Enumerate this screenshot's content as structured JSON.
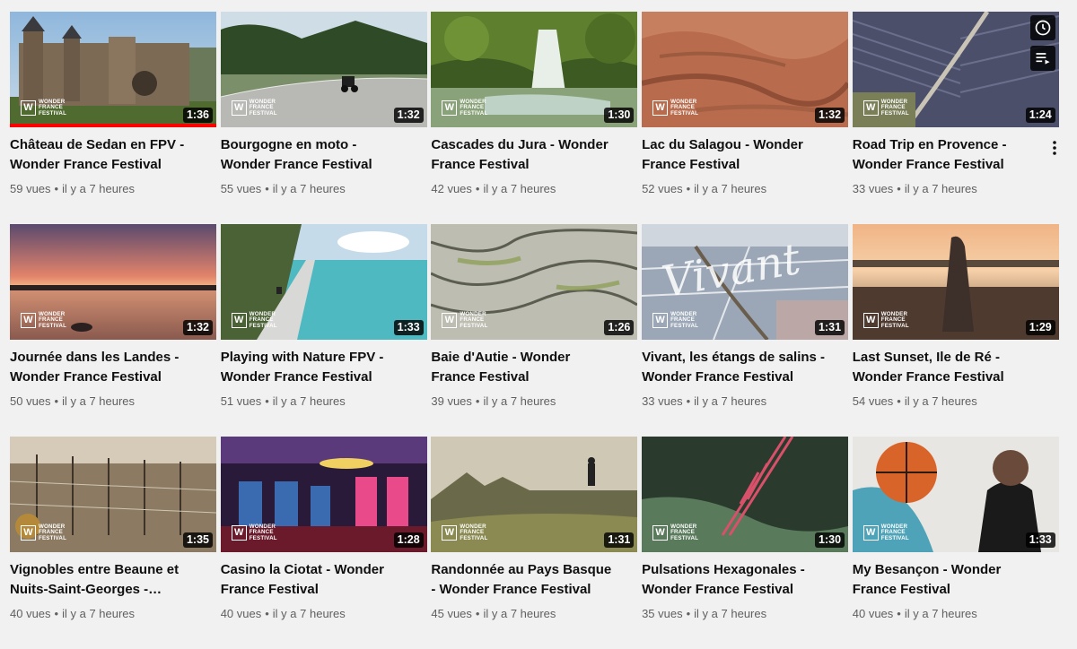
{
  "brand_logo": {
    "mark": "W",
    "line1": "Wonder",
    "line2": "France",
    "line3": "Festival"
  },
  "colors": {
    "progress": "#ff0000",
    "meta_text": "#606060",
    "background": "#f1f1f1"
  },
  "hover_actions": {
    "watch_later_icon": "clock-icon",
    "add_to_queue_icon": "queue-icon",
    "menu_icon": "more-vert-icon"
  },
  "videos": [
    {
      "title": "Château de Sedan en FPV - Wonder France Festival",
      "duration": "1:36",
      "views": "59 vues",
      "age": "il y a 7 heures",
      "scene": "castle",
      "watched_fraction": 1.0
    },
    {
      "title": "Bourgogne en moto - Wonder France Festival",
      "duration": "1:32",
      "views": "55 vues",
      "age": "il y a 7 heures",
      "scene": "road"
    },
    {
      "title": "Cascades du Jura - Wonder France Festival",
      "duration": "1:30",
      "views": "42 vues",
      "age": "il y a 7 heures",
      "scene": "waterfall"
    },
    {
      "title": "Lac du Salagou - Wonder France Festival",
      "duration": "1:32",
      "views": "52 vues",
      "age": "il y a 7 heures",
      "scene": "redearth"
    },
    {
      "title": "Road Trip en Provence - Wonder France Festival",
      "duration": "1:24",
      "views": "33 vues",
      "age": "il y a 7 heures",
      "scene": "fields"
    },
    {
      "title": "Journée dans les Landes - Wonder France Festival",
      "duration": "1:32",
      "views": "50 vues",
      "age": "il y a 7 heures",
      "scene": "sunset"
    },
    {
      "title": "Playing with Nature FPV - Wonder France Festival",
      "duration": "1:33",
      "views": "51 vues",
      "age": "il y a 7 heures",
      "scene": "lake"
    },
    {
      "title": "Baie d'Autie - Wonder France Festival",
      "duration": "1:26",
      "views": "39 vues",
      "age": "il y a 7 heures",
      "scene": "sand"
    },
    {
      "title": "Vivant, les étangs de salins - Wonder France Festival",
      "duration": "1:31",
      "views": "33 vues",
      "age": "il y a 7 heures",
      "scene": "salins",
      "overlay_text": "Vivant"
    },
    {
      "title": "Last Sunset, Ile de Ré - Wonder France Festival",
      "duration": "1:29",
      "views": "54 vues",
      "age": "il y a 7 heures",
      "scene": "beach"
    },
    {
      "title": "Vignobles entre Beaune et Nuits-Saint-Georges -…",
      "duration": "1:35",
      "views": "40 vues",
      "age": "il y a 7 heures",
      "scene": "vineyard"
    },
    {
      "title": "Casino la Ciotat - Wonder France Festival",
      "duration": "1:28",
      "views": "40 vues",
      "age": "il y a 7 heures",
      "scene": "casino"
    },
    {
      "title": "Randonnée au Pays Basque - Wonder France Festival",
      "duration": "1:31",
      "views": "45 vues",
      "age": "il y a 7 heures",
      "scene": "hike"
    },
    {
      "title": "Pulsations Hexagonales - Wonder France Festival",
      "duration": "1:30",
      "views": "35 vues",
      "age": "il y a 7 heures",
      "scene": "viaduct"
    },
    {
      "title": "My Besançon - Wonder France Festival",
      "duration": "1:33",
      "views": "40 vues",
      "age": "il y a 7 heures",
      "scene": "basketball"
    }
  ]
}
